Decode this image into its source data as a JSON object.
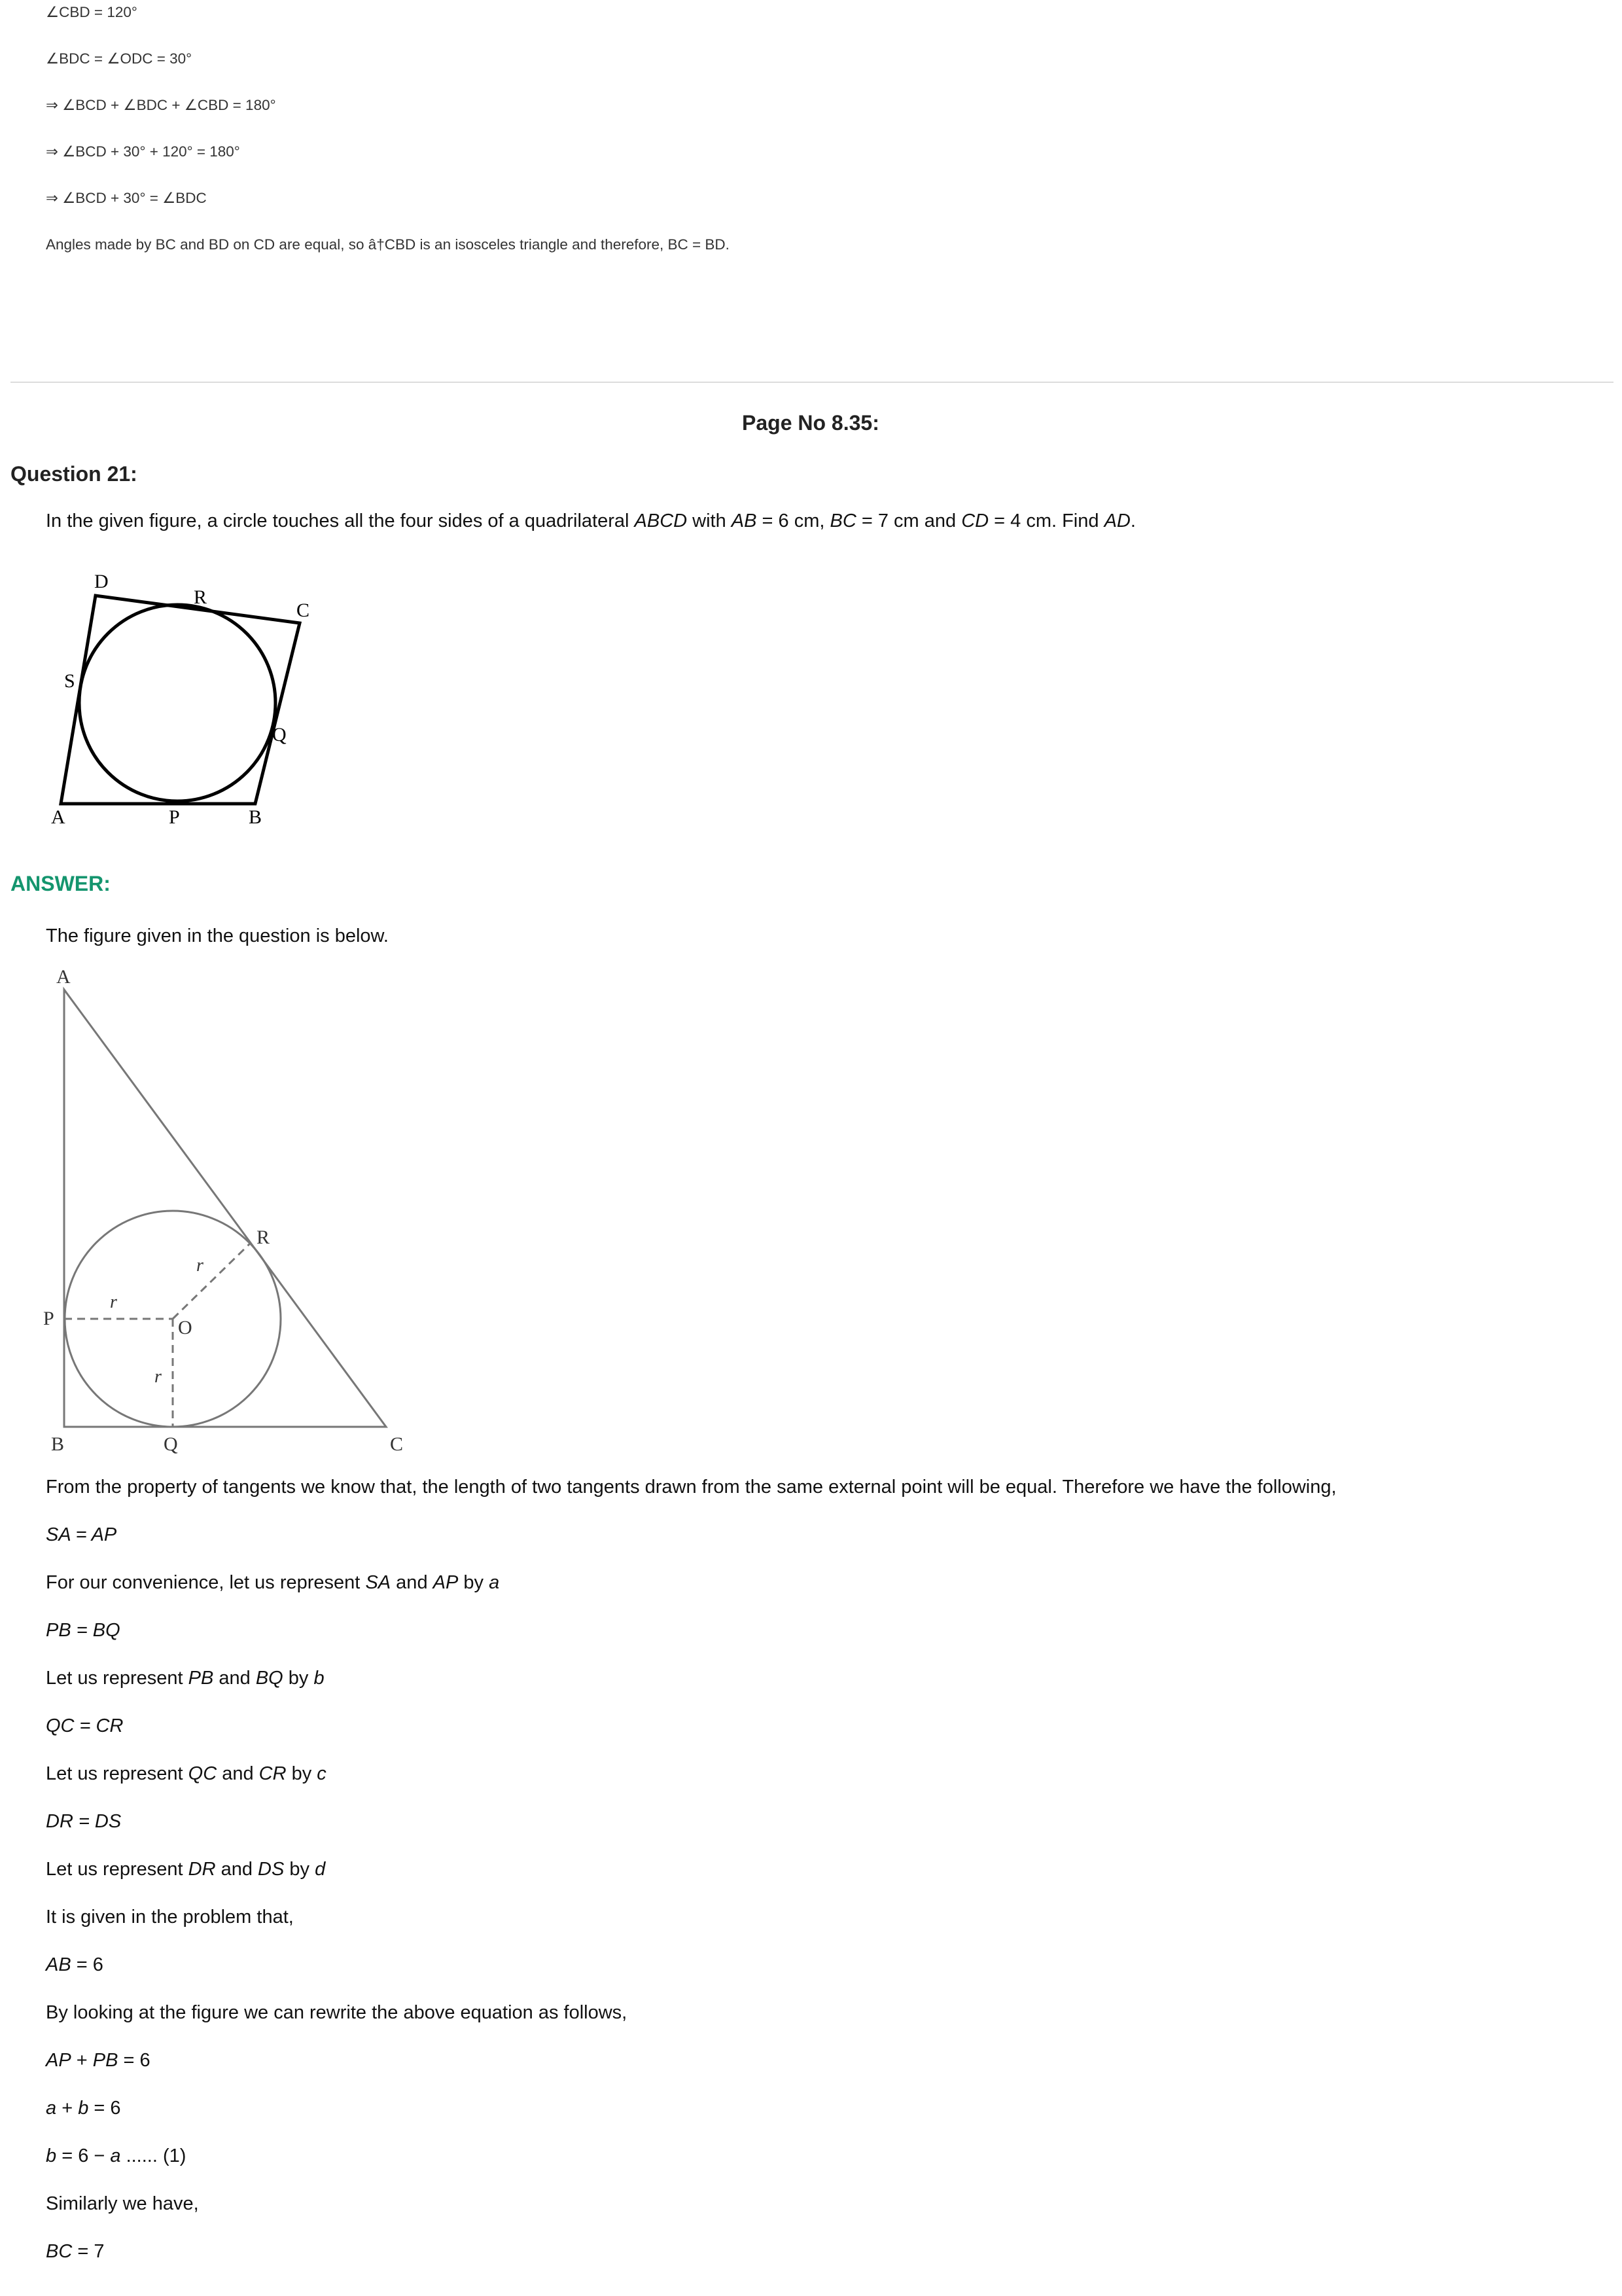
{
  "prev_solution": {
    "lines": [
      "∠CBD = 120°",
      "∠BDC = ∠ODC = 30°",
      "⇒ ∠BCD + ∠BDC + ∠CBD = 180°",
      "⇒ ∠BCD + 30° + 120° = 180°",
      "⇒ ∠BCD + 30° = ∠BDC",
      "Angles made by BC and BD on CD are equal, so â†CBD is an isosceles triangle and therefore, BC = BD."
    ]
  },
  "page_label": "Page No 8.35:",
  "question": {
    "title": "Question 21:",
    "text_parts": [
      "In the given figure, a circle touches all the four sides of a quadrilateral ",
      "ABCD",
      " with ",
      "AB",
      " = 6 cm, ",
      "BC",
      " = 7 cm and ",
      "CD",
      " = 4 cm. Find ",
      "AD",
      "."
    ],
    "figure_labels": {
      "A": "A",
      "B": "B",
      "C": "C",
      "D": "D",
      "P": "P",
      "Q": "Q",
      "R": "R",
      "S": "S"
    }
  },
  "answer": {
    "title": "ANSWER:",
    "intro": "The figure given in the question is below.",
    "figure_labels": {
      "A": "A",
      "B": "B",
      "C": "C",
      "P": "P",
      "Q": "Q",
      "R": "R",
      "O": "O",
      "r": "r"
    },
    "property_text": "From the property of tangents we know that, the length of two tangents drawn from the same external point will be equal. Therefore we have the following,",
    "sa_ap": "SA = AP",
    "rep_a": [
      "For our convenience, let us represent ",
      "SA",
      " and ",
      "AP",
      " by ",
      "a"
    ],
    "pb_bq": "PB = BQ",
    "rep_b": [
      "Let us represent ",
      "PB",
      " and ",
      "BQ",
      " by ",
      "b"
    ],
    "qc_cr": "QC = CR",
    "rep_c": [
      "Let us represent ",
      "QC",
      " and ",
      "CR",
      " by ",
      "c"
    ],
    "dr_ds": "DR = DS",
    "rep_d": [
      "Let us represent ",
      "DR",
      " and ",
      "DS",
      " by ",
      "d"
    ],
    "given_text": "It is given in the problem that,",
    "ab_eq": [
      "AB",
      " = 6"
    ],
    "rewrite_text": "By looking at the figure we can rewrite the above equation as follows,",
    "ap_pb_eq": [
      "AP",
      " + ",
      "PB",
      " = 6"
    ],
    "a_b_eq": [
      "a",
      " + ",
      "b",
      " = 6"
    ],
    "b_eq": [
      "b",
      " = 6 − ",
      "a",
      " ...... (1)"
    ],
    "similarly": "Similarly we have,",
    "bc_eq": [
      "BC",
      " = 7"
    ]
  }
}
